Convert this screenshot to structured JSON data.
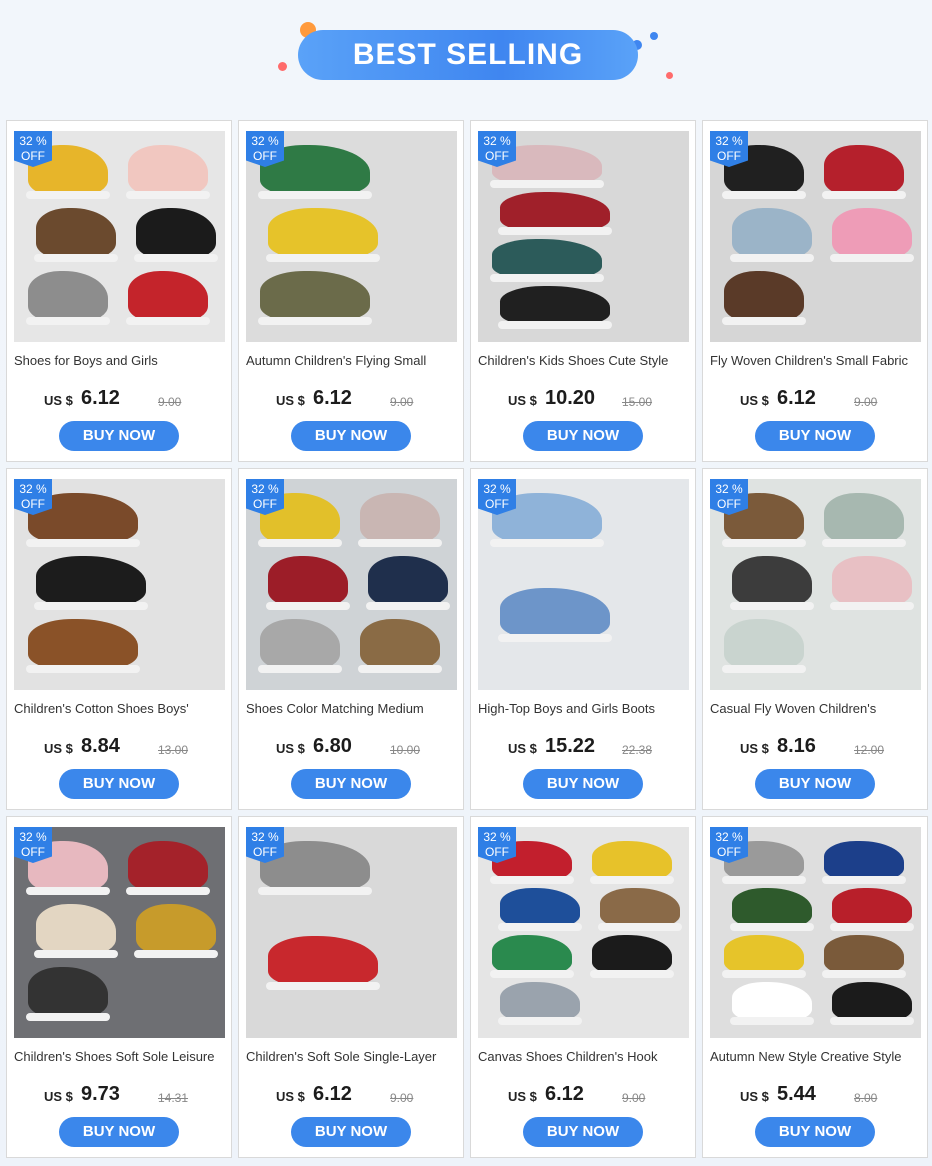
{
  "banner": {
    "title": "BEST SELLING"
  },
  "colors": {
    "accent": "#3b87eb",
    "badge": "#2f7fe6"
  },
  "products": [
    {
      "badge_pct": "32 %",
      "badge_off": "OFF",
      "title": "Shoes for Boys and Girls",
      "currency": "US $",
      "price": "6.12",
      "old_price": "9.00",
      "button": "BUY NOW",
      "bg": "#e6e6e6",
      "shoes": [
        "#e7b52a",
        "#f1c7c0",
        "#6b4a2e",
        "#1b1b1b",
        "#8d8d8d",
        "#c4242b"
      ]
    },
    {
      "badge_pct": "32 %",
      "badge_off": "OFF",
      "title": "Autumn Children's Flying Small",
      "currency": "US $",
      "price": "6.12",
      "old_price": "9.00",
      "button": "BUY NOW",
      "bg": "#dcdcdc",
      "shoes": [
        "#2f7a45",
        "#e6c32a",
        "#6b6b4a"
      ]
    },
    {
      "badge_pct": "32 %",
      "badge_off": "OFF",
      "title": "Children's Kids Shoes Cute Style",
      "currency": "US $",
      "price": "10.20",
      "old_price": "15.00",
      "button": "BUY NOW",
      "bg": "#d8d8d8",
      "shoes": [
        "#d9b9bd",
        "#a0202a",
        "#2c5b5a",
        "#202020"
      ]
    },
    {
      "badge_pct": "32 %",
      "badge_off": "OFF",
      "title": "Fly Woven Children's Small Fabric",
      "currency": "US $",
      "price": "6.12",
      "old_price": "9.00",
      "button": "BUY NOW",
      "bg": "#d6d6d6",
      "shoes": [
        "#202020",
        "#b5202c",
        "#9bb4c8",
        "#ee9cb7",
        "#5a3a28"
      ]
    },
    {
      "badge_pct": "32 %",
      "badge_off": "OFF",
      "title": "Children's Cotton Shoes Boys'",
      "currency": "US $",
      "price": "8.84",
      "old_price": "13.00",
      "button": "BUY NOW",
      "bg": "#e2e2e2",
      "shoes": [
        "#7a4a2a",
        "#1c1c1c",
        "#8a5228"
      ]
    },
    {
      "badge_pct": "32 %",
      "badge_off": "OFF",
      "title": "Shoes Color Matching Medium",
      "currency": "US $",
      "price": "6.80",
      "old_price": "10.00",
      "button": "BUY NOW",
      "bg": "#cfd3d6",
      "shoes": [
        "#e2c02a",
        "#c9b6b3",
        "#9c1d28",
        "#1f2f4c",
        "#a8a8a8",
        "#8a6b45"
      ]
    },
    {
      "badge_pct": "32 %",
      "badge_off": "OFF",
      "title": "High-Top Boys and Girls Boots",
      "currency": "US $",
      "price": "15.22",
      "old_price": "22.38",
      "button": "BUY NOW",
      "bg": "#e4e7ea",
      "shoes": [
        "#8fb3d9",
        "#6d95c9"
      ]
    },
    {
      "badge_pct": "32 %",
      "badge_off": "OFF",
      "title": "Casual Fly Woven Children's",
      "currency": "US $",
      "price": "8.16",
      "old_price": "12.00",
      "button": "BUY NOW",
      "bg": "#dfe3e1",
      "shoes": [
        "#7b5a3a",
        "#a7b8b0",
        "#3c3c3c",
        "#e8c0c4",
        "#c9d4cf"
      ]
    },
    {
      "badge_pct": "32 %",
      "badge_off": "OFF",
      "title": "Children's Shoes Soft Sole Leisure",
      "currency": "US $",
      "price": "9.73",
      "old_price": "14.31",
      "button": "BUY NOW",
      "bg": "#6e6f73",
      "shoes": [
        "#e7b8bf",
        "#a4222a",
        "#e3d6c2",
        "#c79b2b",
        "#333333"
      ]
    },
    {
      "badge_pct": "32 %",
      "badge_off": "OFF",
      "title": "Children's Soft Sole Single-Layer",
      "currency": "US $",
      "price": "6.12",
      "old_price": "9.00",
      "button": "BUY NOW",
      "bg": "#d9d9d9",
      "shoes": [
        "#8d8d8d",
        "#c8282d"
      ]
    },
    {
      "badge_pct": "32 %",
      "badge_off": "OFF",
      "title": "Canvas Shoes Children's Hook",
      "currency": "US $",
      "price": "6.12",
      "old_price": "9.00",
      "button": "BUY NOW",
      "bg": "#e5e5e5",
      "shoes": [
        "#c21f2d",
        "#e7c22a",
        "#1e4f9a",
        "#8a6a48",
        "#2a8a4e",
        "#1b1b1b",
        "#9aa3ad"
      ]
    },
    {
      "badge_pct": "32 %",
      "badge_off": "OFF",
      "title": "Autumn New Style Creative Style",
      "currency": "US $",
      "price": "5.44",
      "old_price": "8.00",
      "button": "BUY NOW",
      "bg": "#dedede",
      "shoes": [
        "#9a9a9a",
        "#1c3f8a",
        "#2e5a2c",
        "#b81f2a",
        "#e6c42a",
        "#7a5a3a",
        "#ffffff",
        "#1b1b1b"
      ]
    }
  ]
}
